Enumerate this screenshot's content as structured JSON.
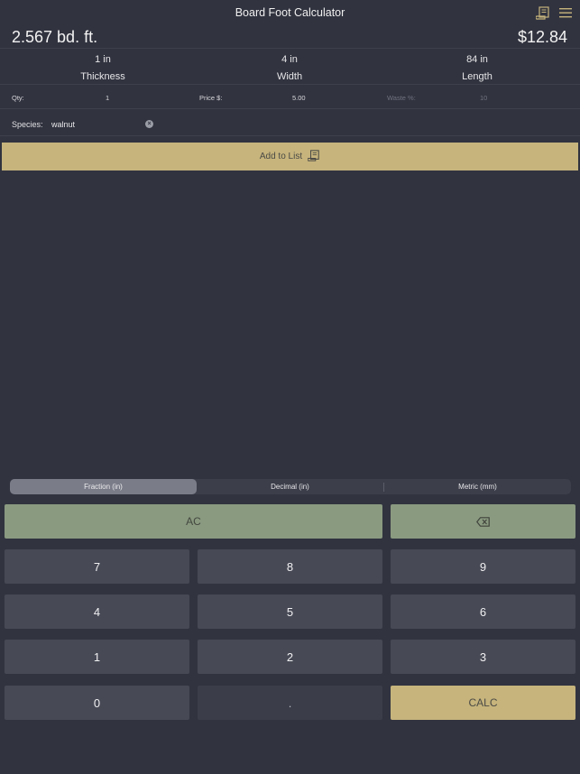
{
  "header": {
    "title": "Board Foot Calculator",
    "list_icon": "receipt-list-icon",
    "menu_icon": "hamburger-menu-icon"
  },
  "result": {
    "board_feet": "2.567 bd. ft.",
    "total_price": "$12.84"
  },
  "dimensions": [
    {
      "value": "1 in",
      "label": "Thickness"
    },
    {
      "value": "4 in",
      "label": "Width"
    },
    {
      "value": "84 in",
      "label": "Length"
    }
  ],
  "fields": {
    "qty_label": "Qty:",
    "qty_value": "1",
    "price_label": "Price $:",
    "price_value": "5.00",
    "waste_label": "Waste %:",
    "waste_value": "10"
  },
  "species": {
    "label": "Species:",
    "value": "walnut"
  },
  "add_button": {
    "label": "Add to List"
  },
  "units_tabs": [
    {
      "label": "Fraction (in)",
      "active": true
    },
    {
      "label": "Decimal (in)",
      "active": false
    },
    {
      "label": "Metric (mm)",
      "active": false
    }
  ],
  "keypad": {
    "ac": "AC",
    "k7": "7",
    "k8": "8",
    "k9": "9",
    "k4": "4",
    "k5": "5",
    "k6": "6",
    "k1": "1",
    "k2": "2",
    "k3": "3",
    "k0": "0",
    "dot": ".",
    "calc": "CALC"
  },
  "colors": {
    "background": "#31333f",
    "accent_gold": "#c6b47c",
    "accent_green": "#8a9a80",
    "key": "#474955"
  }
}
